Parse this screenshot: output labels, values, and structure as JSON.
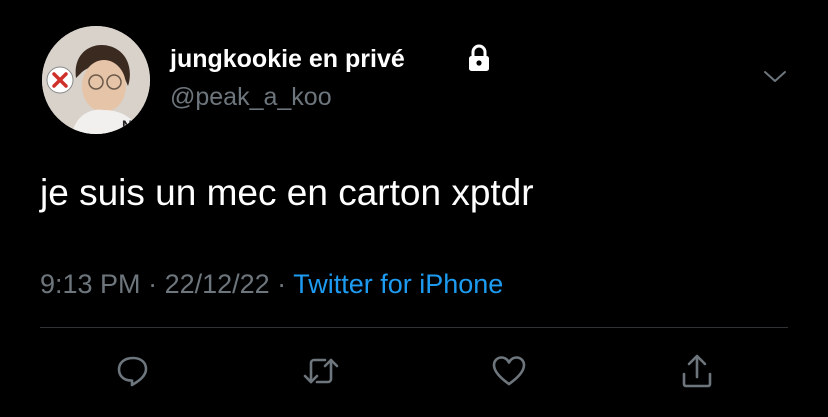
{
  "tweet": {
    "display_name": "jungkookie en privé",
    "handle": "@peak_a_koo",
    "text": "je suis un mec en carton xptdr",
    "time": "9:13 PM",
    "separator1": " · ",
    "date": "22/12/22",
    "separator2": " · ",
    "source": "Twitter for iPhone"
  },
  "icons": {
    "account": "lock-icon",
    "menu": "chevron-down-icon",
    "actions": [
      "reply-icon",
      "retweet-icon",
      "like-icon",
      "share-icon"
    ]
  },
  "colors": {
    "background": "#000000",
    "primary_text": "#ffffff",
    "secondary_text": "#6e767d",
    "link": "#1d9bf0",
    "divider": "#2f3336"
  }
}
